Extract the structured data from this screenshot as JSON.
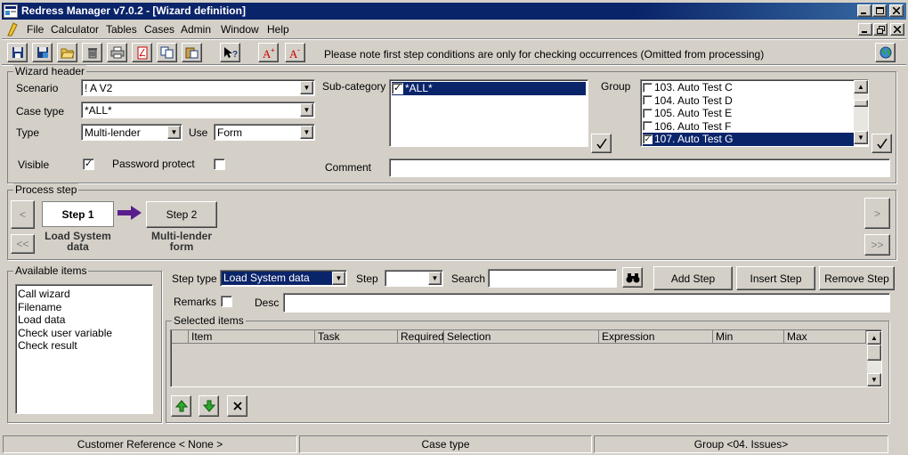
{
  "window": {
    "title": "Redress Manager v7.0.2 - [Wizard definition]",
    "title_bar_color": "#0a246a"
  },
  "menu": [
    "File",
    "Calculator",
    "Tables",
    "Cases",
    "Admin",
    "Window",
    "Help"
  ],
  "toolbar": {
    "icons": [
      "save-icon",
      "save-as-icon",
      "open-folder-icon",
      "delete-icon",
      "print-icon",
      "pdf-icon",
      "copy-icon",
      "paste-icon",
      "help-cursor-icon",
      "font-increase-icon",
      "font-decrease-icon"
    ],
    "note": "Please note first step conditions are only for checking occurrences (Omitted from processing)"
  },
  "wizard_header": {
    "title": "Wizard header",
    "scenario_label": "Scenario",
    "scenario_value": "! A V2",
    "case_type_label": "Case type",
    "case_type_value": "*ALL*",
    "type_label": "Type",
    "type_value": "Multi-lender",
    "use_label": "Use",
    "use_value": "Form",
    "visible_label": "Visible",
    "visible_checked": true,
    "password_label": "Password protect",
    "password_checked": false,
    "subcategory_label": "Sub-category",
    "subcategory_items": [
      {
        "label": "*ALL*",
        "checked": true,
        "selected": true
      }
    ],
    "group_label": "Group",
    "group_items": [
      {
        "label": "103. Auto Test C",
        "checked": false,
        "selected": false
      },
      {
        "label": "104. Auto Test D",
        "checked": false,
        "selected": false
      },
      {
        "label": "105. Auto Test E",
        "checked": false,
        "selected": false
      },
      {
        "label": "106. Auto Test F",
        "checked": false,
        "selected": false
      },
      {
        "label": "107. Auto Test G",
        "checked": true,
        "selected": true
      }
    ],
    "comment_label": "Comment",
    "comment_value": ""
  },
  "process_step": {
    "title": "Process step",
    "nav_prev": "<",
    "nav_first": "<<",
    "nav_next": ">",
    "nav_last": ">>",
    "steps": [
      {
        "label": "Step 1",
        "caption_line1": "Load System",
        "caption_line2": "data",
        "active": true
      },
      {
        "label": "Step 2",
        "caption_line1": "Multi-lender",
        "caption_line2": "form",
        "active": false
      }
    ]
  },
  "available_items": {
    "title": "Available items",
    "items": [
      "Call wizard",
      "Filename",
      "Load data",
      "Check user variable",
      "Check result"
    ]
  },
  "step_editor": {
    "step_type_label": "Step type",
    "step_type_value": "Load System data",
    "step_label": "Step",
    "step_value": "",
    "search_label": "Search",
    "search_value": "",
    "add_step": "Add Step",
    "insert_step": "Insert Step",
    "remove_step": "Remove Step",
    "remarks_label": "Remarks",
    "remarks_checked": false,
    "desc_label": "Desc",
    "desc_value": ""
  },
  "selected_items": {
    "title": "Selected items",
    "columns": [
      "",
      "Item",
      "Task",
      "Required",
      "Selection",
      "Expression",
      "Min",
      "Max"
    ]
  },
  "status_bar": {
    "customer_reference": "Customer Reference < None >",
    "case_type": "Case type",
    "group": "Group <04. Issues>"
  },
  "colors": {
    "selection": "#0a246a",
    "arrow": "#5a1d8c",
    "move_up_green": "#2ea82e"
  }
}
